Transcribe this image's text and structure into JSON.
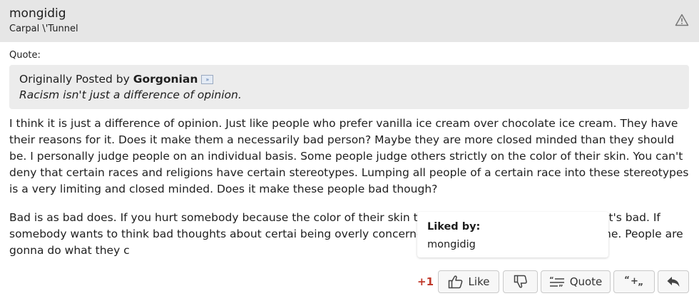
{
  "post": {
    "author": "mongidig",
    "author_title": "Carpal \\'Tunnel"
  },
  "quote": {
    "label": "Quote:",
    "originally_posted_by": "Originally Posted by",
    "quoted_author": "Gorgonian",
    "view_post_icon": "view-post-arrow",
    "quoted_text": "Racism isn't just a difference of opinion."
  },
  "body": {
    "paragraph1": "I think it is just a difference of opinion. Just like people who prefer vanilla ice cream over chocolate ice cream. They have their reasons for it. Does it make them a necessarily bad person? Maybe they are more closed minded than they should be. I personally judge people on an individual basis. Some people judge others strictly on the color of their skin. You can't deny that certain races and religions have certain stereotypes. Lumping all people of a certain race into these stereotypes is a very limiting and closed minded. Does it make these people bad though?",
    "paragraph2": "Bad is as bad does. If you hurt somebody because the color of their skin that i just because of their race that's bad. If somebody wants to think bad thoughts about certai being overly concerned about \"racism\" is a waste of time. People are gonna do what they c"
  },
  "liked_popup": {
    "title": "Liked by:",
    "users": [
      "mongidig"
    ]
  },
  "actions": {
    "like_count": "+1",
    "like_label": "Like",
    "quote_label": "Quote"
  },
  "colors": {
    "header_bg": "#e6e6e6",
    "quote_bg": "#ececec",
    "like_count": "#c0392b"
  }
}
